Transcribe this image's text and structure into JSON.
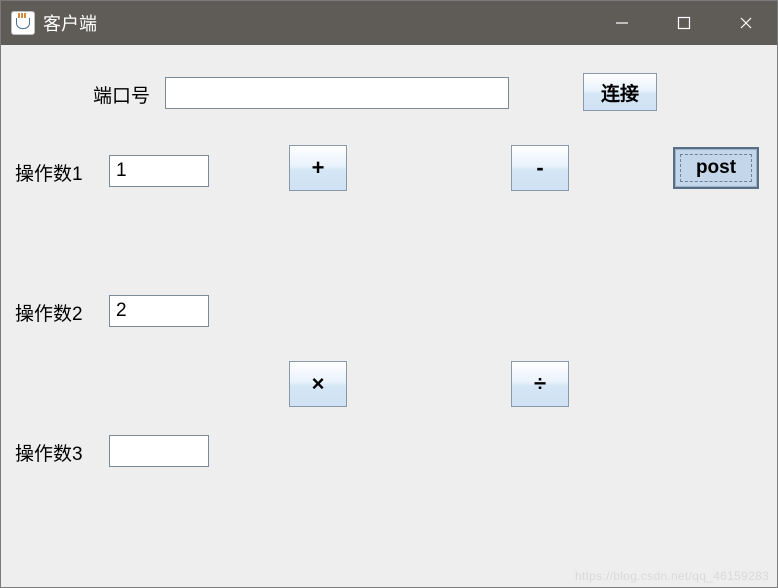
{
  "window": {
    "title": "客户端"
  },
  "port": {
    "label": "端口号",
    "value": "",
    "connect_label": "连接"
  },
  "operands": {
    "op1": {
      "label": "操作数1",
      "value": "1"
    },
    "op2": {
      "label": "操作数2",
      "value": "2"
    },
    "op3": {
      "label": "操作数3",
      "value": ""
    }
  },
  "buttons": {
    "plus": "+",
    "minus": "-",
    "multiply": "×",
    "divide": "÷",
    "post": "post"
  },
  "watermark": "https://blog.csdn.net/qq_46159283"
}
